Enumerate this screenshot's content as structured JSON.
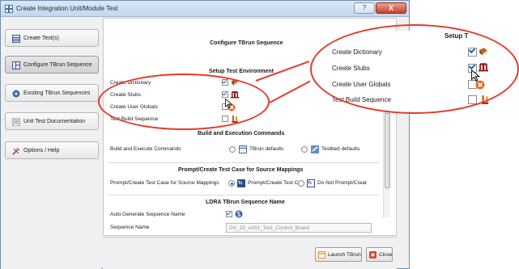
{
  "window": {
    "title": "Create Integration Unit/Module Test",
    "help_btn": "?",
    "close_btn": "X"
  },
  "sidebar": {
    "items": [
      {
        "label": "Create Test(s)",
        "icon": "create-test-icon"
      },
      {
        "label": "Configure TBrun Sequence",
        "icon": "configure-sequence-icon",
        "active": true
      },
      {
        "label": "Existing TBrun Sequences",
        "icon": "existing-sequence-icon"
      },
      {
        "label": "Unit Test Documentation",
        "icon": "documentation-icon"
      },
      {
        "label": "Options / Help",
        "icon": "options-icon"
      }
    ]
  },
  "main": {
    "title": "Configure TBrun Sequence",
    "setup": {
      "title": "Setup Test Environment",
      "rows": [
        {
          "label": "Create Dictionary",
          "checked": true,
          "icon": "dictionary-book-icon"
        },
        {
          "label": "Create Stubs",
          "checked": true,
          "icon": "stubs-icon"
        },
        {
          "label": "Create User Globals",
          "checked": false,
          "icon": "globals-disabled-icon"
        },
        {
          "label": "Test Build Sequence",
          "checked": false,
          "icon": "build-sequence-icon"
        }
      ]
    },
    "build": {
      "title": "Build and Execution Commands",
      "label": "Build and Execute Commands",
      "opt1": "TBrun defaults",
      "opt2": "Testbed defaults"
    },
    "prompt": {
      "title": "Prompt/Create Test Case for Source Mappings",
      "label": "Prompt/Create Test Case for Source Mappings",
      "tc_badge": "Tc",
      "opt1": "Prompt/Create Test C",
      "opt2": "Do Not Prompt/Creat"
    },
    "name": {
      "title": "LDRA TBrun Sequence Name",
      "auto_label": "Auto Generate Sequence Name",
      "auto_checked": true,
      "seq_label": "Sequence Name",
      "seq_value": "DV_15_u001_Test_Control_Board"
    }
  },
  "buttons": {
    "launch": "Launch TBrun",
    "close": "Close"
  },
  "zoom": {
    "header": "Setup T",
    "rows": [
      {
        "label": "Create Dictionary",
        "checked": true
      },
      {
        "label": "Create Stubs",
        "checked": true
      },
      {
        "label": "Create User Globals",
        "checked": false
      },
      {
        "label": "Test Build Sequence",
        "checked": false
      }
    ]
  },
  "colors": {
    "annotation": "#e8382c",
    "accent": "#1e5fb3",
    "stub_icon": "#8b1a1a"
  }
}
